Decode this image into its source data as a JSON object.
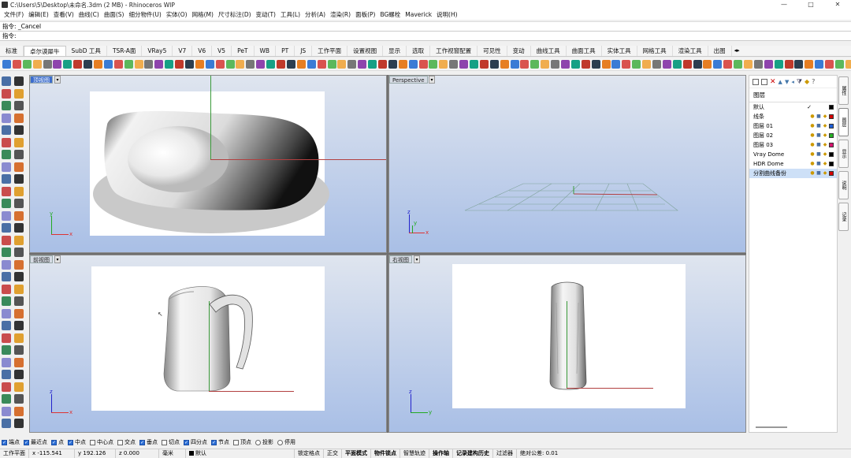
{
  "window": {
    "title": "C:\\Users\\5\\Desktop\\未命名.3dm (2 MB) - Rhinoceros WIP",
    "controls": [
      "—",
      "□",
      "✕"
    ]
  },
  "menubar": [
    "文件(F)",
    "编辑(E)",
    "查看(V)",
    "曲线(C)",
    "曲面(S)",
    "细分物件(U)",
    "实体(O)",
    "网格(M)",
    "尺寸标注(D)",
    "变动(T)",
    "工具(L)",
    "分析(A)",
    "渲染(R)",
    "面板(P)",
    "BG螺栓",
    "Maverick",
    "说明(H)"
  ],
  "command": {
    "history": "指令: _Cancel",
    "prompt": "指令:",
    "value": ""
  },
  "tabs": [
    "标准",
    "卓尔谟犀牛",
    "SubD 工具",
    "TSR-A面",
    "VRay5",
    "V7",
    "V6",
    "V5",
    "PeT",
    "WB",
    "PT",
    "JS",
    "工作平面",
    "设置视图",
    "显示",
    "选取",
    "工作视窗配置",
    "可见性",
    "变动",
    "曲线工具",
    "曲面工具",
    "实体工具",
    "网格工具",
    "渲染工具",
    "出图"
  ],
  "active_tab": "卓尔谟犀牛",
  "viewports": {
    "top": {
      "label": "顶视图",
      "axis_a": "x",
      "axis_b": "y"
    },
    "perspective": {
      "label": "Perspective",
      "axis_a": "x",
      "axis_b": "y",
      "axis_c": "z"
    },
    "front": {
      "label": "前视图",
      "axis_a": "x",
      "axis_b": "z"
    },
    "right": {
      "label": "右视图",
      "axis_a": "y",
      "axis_b": "z"
    }
  },
  "panel": {
    "heading": "图层",
    "layers": [
      {
        "name": "默认",
        "color": "#000000",
        "current": true
      },
      {
        "name": "线条",
        "color": "#d40000"
      },
      {
        "name": "图层 01",
        "color": "#1f5fd6"
      },
      {
        "name": "图层 02",
        "color": "#26b026"
      },
      {
        "name": "图层 03",
        "color": "#d4146e"
      },
      {
        "name": "Vray Dome",
        "color": "#000000"
      },
      {
        "name": "HDR Dome",
        "color": "#000000"
      },
      {
        "name": "分割曲线备份",
        "color": "#d40000",
        "selected": true
      }
    ],
    "side_tabs": [
      "属性",
      "图层",
      "显示",
      "说明",
      "记录"
    ]
  },
  "osnaps": [
    {
      "label": "端点",
      "on": true
    },
    {
      "label": "最近点",
      "on": true
    },
    {
      "label": "点",
      "on": true
    },
    {
      "label": "中点",
      "on": true
    },
    {
      "label": "中心点",
      "on": false
    },
    {
      "label": "交点",
      "on": false
    },
    {
      "label": "垂点",
      "on": true
    },
    {
      "label": "切点",
      "on": false
    },
    {
      "label": "四分点",
      "on": true
    },
    {
      "label": "节点",
      "on": true
    },
    {
      "label": "顶点",
      "on": false
    },
    {
      "label": "投影",
      "on": false,
      "dot": true
    },
    {
      "label": "停用",
      "on": false,
      "dot": true
    }
  ],
  "status": {
    "cplane": "工作平面",
    "x": "x -115.541",
    "y": "y 192.126",
    "z": "z 0.000",
    "units": "毫米",
    "layer": "默认",
    "toggles": [
      "锁定格点",
      "正交",
      "平面模式",
      "物件锁点",
      "智慧轨迹",
      "操作轴",
      "记录建构历史",
      "过滤器"
    ],
    "tolerance": "绝对公差: 0.01"
  }
}
